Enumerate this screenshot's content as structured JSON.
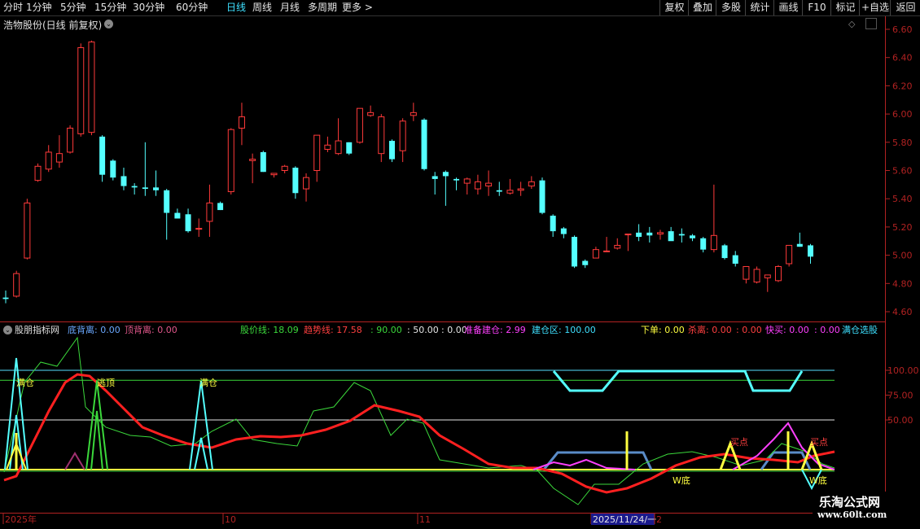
{
  "toolbar": {
    "periods": [
      "分时",
      "1分钟",
      "5分钟",
      "15分钟",
      "30分钟",
      "60分钟",
      "日线",
      "周线",
      "月线",
      "多周期",
      "更多"
    ],
    "active_period": "日线",
    "right_buttons": [
      "复权",
      "叠加",
      "多股",
      "统计",
      "画线",
      "F10",
      "标记",
      "+自选",
      "返回"
    ]
  },
  "main_chart": {
    "title": "浩物股份(日线 前复权)",
    "price_ticks": [
      "6.60",
      "6.40",
      "6.20",
      "6.00",
      "5.80",
      "5.60",
      "5.40",
      "5.20",
      "5.00",
      "4.80",
      "4.60"
    ],
    "candles": [
      [
        4.7,
        4.75,
        4.66,
        4.69
      ],
      [
        4.71,
        4.89,
        4.7,
        4.87
      ],
      [
        4.98,
        5.4,
        4.97,
        5.37
      ],
      [
        5.53,
        5.65,
        5.52,
        5.63
      ],
      [
        5.61,
        5.78,
        5.59,
        5.73
      ],
      [
        5.66,
        5.85,
        5.62,
        5.72
      ],
      [
        5.73,
        5.92,
        5.72,
        5.9
      ],
      [
        5.86,
        6.5,
        5.84,
        6.47
      ],
      [
        5.87,
        6.52,
        5.85,
        6.51
      ],
      [
        5.84,
        5.85,
        5.52,
        5.57
      ],
      [
        5.67,
        5.68,
        5.53,
        5.55
      ],
      [
        5.56,
        5.62,
        5.46,
        5.49
      ],
      [
        5.49,
        5.51,
        5.43,
        5.48
      ],
      [
        5.48,
        5.8,
        5.42,
        5.47
      ],
      [
        5.48,
        5.6,
        5.42,
        5.46
      ],
      [
        5.46,
        5.47,
        5.11,
        5.3
      ],
      [
        5.3,
        5.33,
        5.26,
        5.26
      ],
      [
        5.29,
        5.33,
        5.16,
        5.17
      ],
      [
        5.19,
        5.26,
        5.13,
        5.19
      ],
      [
        5.24,
        5.5,
        5.13,
        5.37
      ],
      [
        5.37,
        5.38,
        5.32,
        5.32
      ],
      [
        5.45,
        5.9,
        5.43,
        5.89
      ],
      [
        5.9,
        6.08,
        5.78,
        5.98
      ],
      [
        5.67,
        5.72,
        5.51,
        5.68
      ],
      [
        5.73,
        5.74,
        5.59,
        5.59
      ],
      [
        5.57,
        5.58,
        5.55,
        5.58
      ],
      [
        5.6,
        5.64,
        5.58,
        5.63
      ],
      [
        5.62,
        5.63,
        5.4,
        5.44
      ],
      [
        5.47,
        5.58,
        5.38,
        5.55
      ],
      [
        5.6,
        5.85,
        5.52,
        5.85
      ],
      [
        5.75,
        5.84,
        5.73,
        5.78
      ],
      [
        5.72,
        5.97,
        5.71,
        5.81
      ],
      [
        5.8,
        5.8,
        5.71,
        5.72
      ],
      [
        5.8,
        6.03,
        5.79,
        6.04
      ],
      [
        5.99,
        6.06,
        5.98,
        6.01
      ],
      [
        5.72,
        6.0,
        5.66,
        5.98
      ],
      [
        5.81,
        5.82,
        5.66,
        5.68
      ],
      [
        5.74,
        5.97,
        5.66,
        5.95
      ],
      [
        5.99,
        6.08,
        5.95,
        6.01
      ],
      [
        5.96,
        5.97,
        5.6,
        5.61
      ],
      [
        5.56,
        5.59,
        5.43,
        5.54
      ],
      [
        5.59,
        5.6,
        5.35,
        5.56
      ],
      [
        5.54,
        5.55,
        5.46,
        5.53
      ],
      [
        5.51,
        5.55,
        5.43,
        5.54
      ],
      [
        5.47,
        5.57,
        5.43,
        5.52
      ],
      [
        5.49,
        5.6,
        5.42,
        5.51
      ],
      [
        5.46,
        5.52,
        5.42,
        5.45
      ],
      [
        5.44,
        5.54,
        5.43,
        5.46
      ],
      [
        5.46,
        5.52,
        5.42,
        5.47
      ],
      [
        5.49,
        5.56,
        5.47,
        5.52
      ],
      [
        5.53,
        5.55,
        5.29,
        5.3
      ],
      [
        5.28,
        5.29,
        5.13,
        5.17
      ],
      [
        5.19,
        5.2,
        5.12,
        5.15
      ],
      [
        5.13,
        5.14,
        4.91,
        4.92
      ],
      [
        4.96,
        4.97,
        4.91,
        4.93
      ],
      [
        4.98,
        5.06,
        4.98,
        5.04
      ],
      [
        5.03,
        5.13,
        5.03,
        5.03
      ],
      [
        5.05,
        5.12,
        5.04,
        5.07
      ],
      [
        5.15,
        5.15,
        5.03,
        5.15
      ],
      [
        5.16,
        5.22,
        5.1,
        5.13
      ],
      [
        5.16,
        5.2,
        5.09,
        5.14
      ],
      [
        5.15,
        5.18,
        5.11,
        5.16
      ],
      [
        5.17,
        5.2,
        5.13,
        5.1
      ],
      [
        5.15,
        5.19,
        5.09,
        5.14
      ],
      [
        5.14,
        5.15,
        5.1,
        5.12
      ],
      [
        5.12,
        5.13,
        5.02,
        5.04
      ],
      [
        5.04,
        5.5,
        5.02,
        5.14
      ],
      [
        5.07,
        5.08,
        4.97,
        4.98
      ],
      [
        5.0,
        5.03,
        4.92,
        4.94
      ],
      [
        4.83,
        4.92,
        4.8,
        4.92
      ],
      [
        4.81,
        4.92,
        4.8,
        4.9
      ],
      [
        4.84,
        4.86,
        4.74,
        4.86
      ],
      [
        4.82,
        4.93,
        4.81,
        4.92
      ],
      [
        4.94,
        5.07,
        4.92,
        5.07
      ],
      [
        5.08,
        5.16,
        5.06,
        5.06
      ],
      [
        5.07,
        5.08,
        4.94,
        4.99
      ]
    ]
  },
  "indicator": {
    "title": "股朋指标网",
    "header_items": [
      {
        "text": "底背离: 0.00",
        "color": "#6aa8ff"
      },
      {
        "text": "顶背离: 0.00",
        "color": "#e0578a"
      },
      {
        "text": "股价线: 18.09",
        "color": "#3bd83b"
      },
      {
        "text": "趋势线: 17.58",
        "color": "#ff4040"
      },
      {
        "text": ": 90.00",
        "color": "#3bd83b"
      },
      {
        "text": ": 50.00",
        "color": "#e6e6e6"
      },
      {
        "text": ": 0.00",
        "color": "#e6e6e6"
      },
      {
        "text": "准备建仓: 2.99",
        "color": "#ff40ff"
      },
      {
        "text": "建仓区: 100.00",
        "color": "#3ee0ff"
      },
      {
        "text": "下单: 0.00",
        "color": "#ffff40"
      },
      {
        "text": "杀离: 0.00",
        "color": "#ff4040"
      },
      {
        "text": ": 0.00",
        "color": "#ff4040"
      },
      {
        "text": "快买: 0.00",
        "color": "#ff40ff"
      },
      {
        "text": ": 0.00",
        "color": "#ff40ff"
      },
      {
        "text": "满仓选股",
        "color": "#3ee0ff"
      }
    ],
    "y_ticks": [
      "100.00",
      "75.00",
      "50.00"
    ],
    "annotations": [
      "满仓",
      "逃顶",
      "满仓",
      "买点",
      "买点",
      "W底",
      "W底"
    ]
  },
  "dates": [
    "2025年",
    "10",
    "11",
    "2025/11/24/一",
    "2"
  ],
  "watermark": {
    "line1": "乐淘公式网",
    "line2": "www.60lt.com"
  },
  "colors": {
    "up": "#ff3a3a",
    "down": "#54ffff",
    "axis": "#b22222",
    "green": "#3bd83b",
    "red": "#ff2020"
  }
}
